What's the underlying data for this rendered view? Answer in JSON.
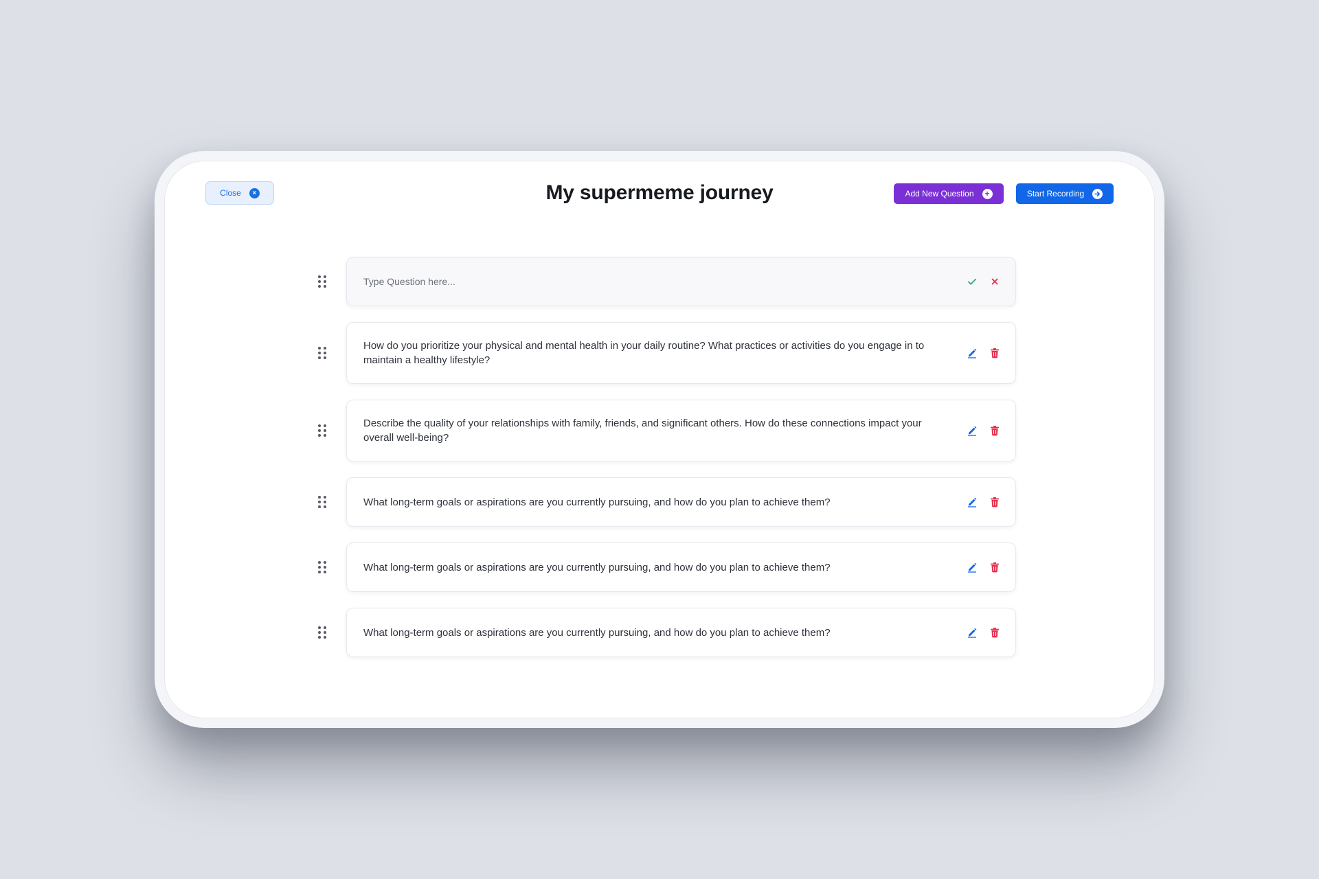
{
  "header": {
    "close_label": "Close",
    "title": "My supermeme journey",
    "add_question_label": "Add New Question",
    "start_recording_label": "Start Recording"
  },
  "new_question": {
    "placeholder": "Type Question here..."
  },
  "questions": [
    {
      "text": "How do you prioritize your physical and mental health in your daily routine? What practices or activities do you engage in to maintain a healthy lifestyle?"
    },
    {
      "text": "Describe the quality of your relationships with family, friends, and significant others. How do these connections impact your overall well-being?"
    },
    {
      "text": "What long-term goals or aspirations are you currently pursuing, and how do you plan to achieve them?"
    },
    {
      "text": "What long-term goals or aspirations are you currently pursuing, and how do you plan to achieve them?"
    },
    {
      "text": "What long-term goals or aspirations are you currently pursuing, and how do you plan to achieve them?"
    }
  ],
  "icons": {
    "close": "close-circle-icon",
    "add": "plus-circle-icon",
    "record": "arrow-right-circle-icon",
    "drag": "drag-handle-icon",
    "confirm": "check-icon",
    "cancel": "x-icon",
    "edit": "pencil-icon",
    "delete": "trash-icon"
  },
  "colors": {
    "background": "#dde0e7",
    "primary_blue": "#1167e8",
    "purple": "#7b30d6",
    "success_green": "#2fa66b",
    "danger_red": "#e5304f"
  }
}
